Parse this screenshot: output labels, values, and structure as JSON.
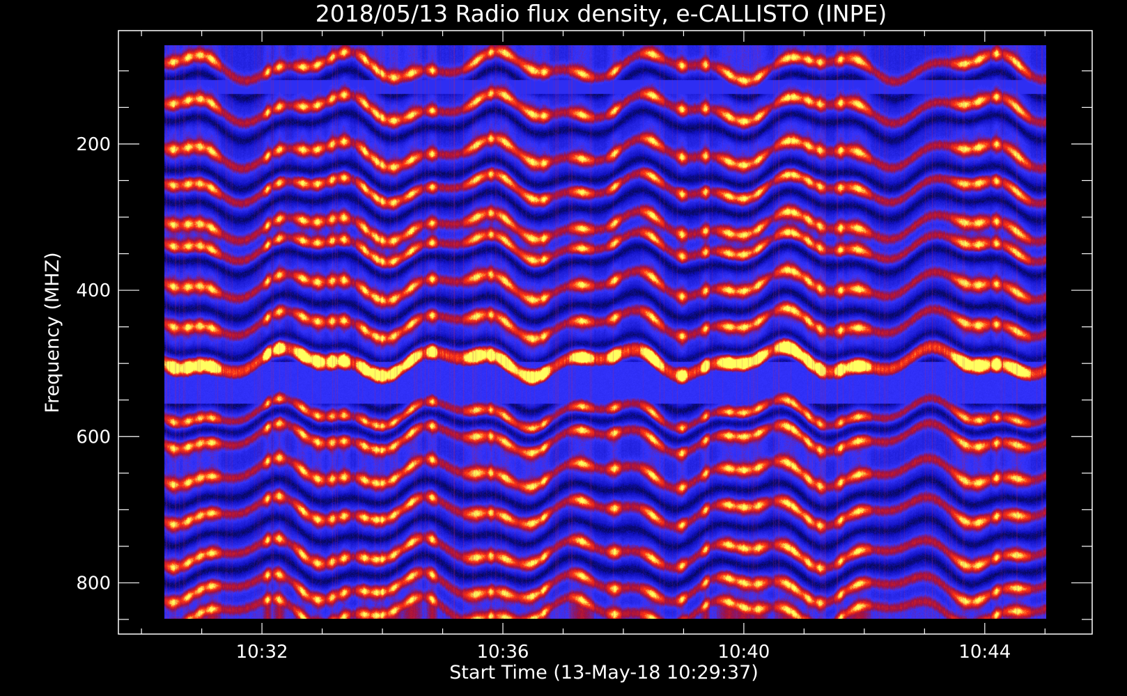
{
  "chart_data": {
    "type": "heatmap",
    "title": "2018/05/13  Radio flux density, e-CALLISTO (INPE)",
    "xlabel": "Start Time (13-May-18 10:29:37)",
    "ylabel": "Frequency (MHZ)",
    "x_ticks": [
      "10:32",
      "10:36",
      "10:40",
      "10:44"
    ],
    "x_tick_minutes": [
      32,
      36,
      40,
      44
    ],
    "x_minor_step_minutes": 1,
    "xlim_minutes": [
      29.617,
      45.783
    ],
    "y_ticks": [
      200,
      400,
      600,
      800
    ],
    "y_minor_step": 50,
    "ylim": [
      45,
      870
    ],
    "y_reversed": true,
    "data_time_range_minutes": [
      30.4,
      45.4
    ],
    "data_freq_range": [
      45,
      870
    ],
    "colormap": [
      "#000000",
      "#1010c0",
      "#3535ff",
      "#a01040",
      "#ff3010",
      "#ffff60"
    ],
    "intensity_peak_freqs": [
      75,
      135,
      200,
      250,
      305,
      335,
      390,
      445,
      495,
      505,
      575,
      610,
      660,
      715,
      775,
      825,
      860
    ],
    "intensity_gap_freqs": [
      100,
      160,
      230,
      275,
      355,
      420,
      480,
      520,
      550,
      590,
      690,
      745,
      800
    ],
    "bright_columns_minutes": [
      30.55,
      30.8,
      31.0,
      31.2,
      32.15,
      32.35,
      32.75,
      33.0,
      33.25,
      33.45,
      33.8,
      34.0,
      34.1,
      34.3,
      34.6,
      34.95,
      35.7,
      35.95,
      36.2,
      36.65,
      36.85,
      37.5,
      38.05,
      38.7,
      39.2,
      39.6,
      40.0,
      40.25,
      40.5,
      41.0,
      41.1,
      41.35,
      41.55,
      41.9,
      42.2,
      44.0,
      44.25,
      44.55,
      44.9
    ],
    "colors": {
      "background": "#000000",
      "axes": "#ffffff",
      "text": "#ffffff"
    }
  }
}
